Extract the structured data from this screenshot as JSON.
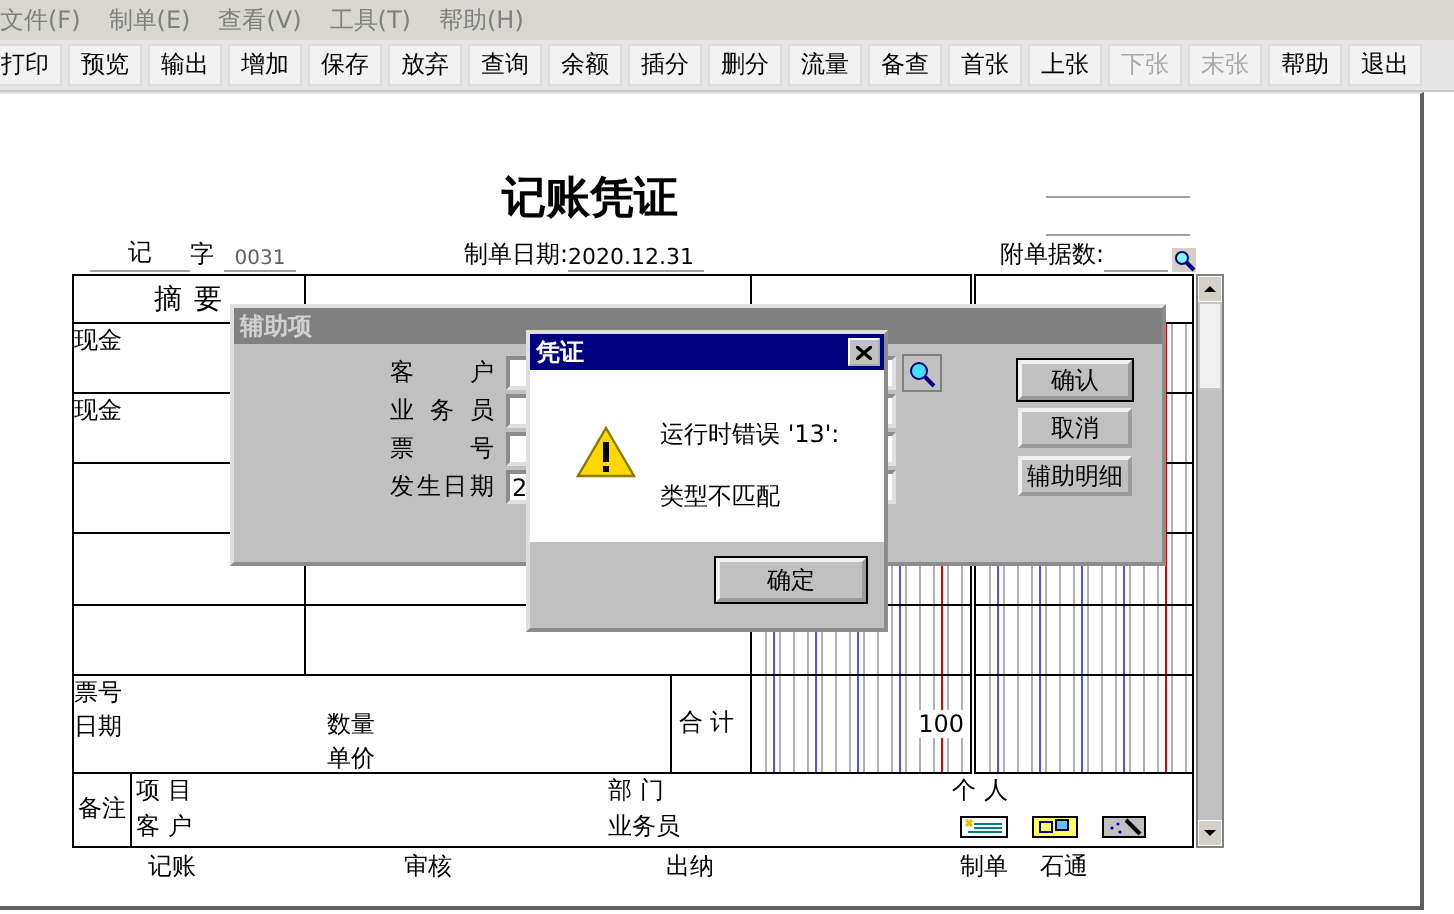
{
  "menu": [
    {
      "label": "文件(F)",
      "disabled": true
    },
    {
      "label": "制单(E)",
      "disabled": true
    },
    {
      "label": "查看(V)",
      "disabled": true
    },
    {
      "label": "工具(T)",
      "disabled": true
    },
    {
      "label": "帮助(H)",
      "disabled": true
    }
  ],
  "toolbar": [
    {
      "label": "打印",
      "disabled": false
    },
    {
      "label": "预览",
      "disabled": false
    },
    {
      "label": "输出",
      "disabled": false
    },
    {
      "label": "增加",
      "disabled": false
    },
    {
      "label": "保存",
      "disabled": false
    },
    {
      "label": "放弃",
      "disabled": false
    },
    {
      "label": "查询",
      "disabled": false
    },
    {
      "label": "余额",
      "disabled": false
    },
    {
      "label": "插分",
      "disabled": false
    },
    {
      "label": "删分",
      "disabled": false
    },
    {
      "label": "流量",
      "disabled": false
    },
    {
      "label": "备查",
      "disabled": false
    },
    {
      "label": "首张",
      "disabled": false
    },
    {
      "label": "上张",
      "disabled": false
    },
    {
      "label": "下张",
      "disabled": true
    },
    {
      "label": "末张",
      "disabled": true
    },
    {
      "label": "帮助",
      "disabled": false
    },
    {
      "label": "退出",
      "disabled": false
    }
  ],
  "voucher": {
    "title": "记账凭证",
    "type_label": "记",
    "type_suffix": "字",
    "number": "0031",
    "date_label": "制单日期:",
    "date": "2020.12.31",
    "attachments_label": "附单据数:",
    "columns": [
      "摘 要"
    ],
    "rows": [
      {
        "summary": "现金"
      },
      {
        "summary": "现金"
      }
    ],
    "ticket_label": "票号",
    "ticket_date_label": "日期",
    "quantity_label": "数量",
    "price_label": "单价",
    "total_label": "合 计",
    "total_debit": "100",
    "remarks": {
      "label": "备注",
      "project": "项 目",
      "customer": "客 户",
      "department": "部 门",
      "salesperson": "业务员",
      "person": "个 人"
    },
    "signatures": [
      {
        "label": "记账"
      },
      {
        "label": "审核"
      },
      {
        "label": "出纳"
      },
      {
        "label": "制单"
      },
      {
        "label": "石通"
      }
    ]
  },
  "aux_dialog": {
    "title": "辅助项",
    "active": false,
    "fields": [
      {
        "label": "客 户"
      },
      {
        "label": "业 务 员"
      },
      {
        "label": "票 号"
      },
      {
        "label": "发生日期",
        "value": "2"
      }
    ],
    "buttons": [
      {
        "label": "确认",
        "default": true
      },
      {
        "label": "取消",
        "default": false
      },
      {
        "label": "辅助明细",
        "default": false
      }
    ]
  },
  "error_dialog": {
    "title": "凭证",
    "active": true,
    "message_lines": [
      "运行时错误 '13':",
      "类型不匹配"
    ],
    "button": "确定"
  }
}
